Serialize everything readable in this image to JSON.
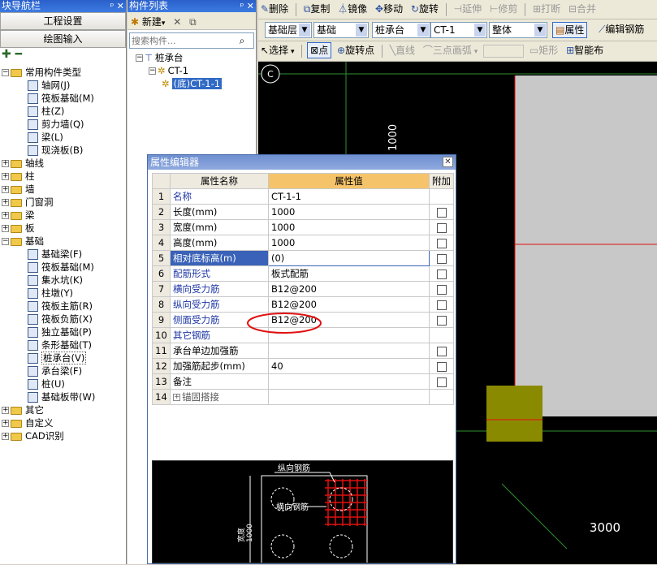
{
  "nav": {
    "title": "块导航栏",
    "controls": "ᵖ ✕",
    "btn_project": "工程设置",
    "btn_draw": "绘图输入",
    "tools": "✚ ━",
    "tree": [
      {
        "label": "常用构件类型",
        "level": 0,
        "type": "folder",
        "exp": "−"
      },
      {
        "label": "轴网(J)",
        "level": 1,
        "type": "item"
      },
      {
        "label": "筏板基础(M)",
        "level": 1,
        "type": "item"
      },
      {
        "label": "柱(Z)",
        "level": 1,
        "type": "item"
      },
      {
        "label": "剪力墙(Q)",
        "level": 1,
        "type": "item"
      },
      {
        "label": "梁(L)",
        "level": 1,
        "type": "item"
      },
      {
        "label": "现浇板(B)",
        "level": 1,
        "type": "item"
      },
      {
        "label": "轴线",
        "level": 0,
        "type": "folder",
        "exp": "+"
      },
      {
        "label": "柱",
        "level": 0,
        "type": "folder",
        "exp": "+"
      },
      {
        "label": "墙",
        "level": 0,
        "type": "folder",
        "exp": "+"
      },
      {
        "label": "门窗洞",
        "level": 0,
        "type": "folder",
        "exp": "+"
      },
      {
        "label": "梁",
        "level": 0,
        "type": "folder",
        "exp": "+"
      },
      {
        "label": "板",
        "level": 0,
        "type": "folder",
        "exp": "+"
      },
      {
        "label": "基础",
        "level": 0,
        "type": "folder",
        "exp": "−"
      },
      {
        "label": "基础梁(F)",
        "level": 1,
        "type": "item"
      },
      {
        "label": "筏板基础(M)",
        "level": 1,
        "type": "item"
      },
      {
        "label": "集水坑(K)",
        "level": 1,
        "type": "item"
      },
      {
        "label": "柱墩(Y)",
        "level": 1,
        "type": "item"
      },
      {
        "label": "筏板主筋(R)",
        "level": 1,
        "type": "item"
      },
      {
        "label": "筏板负筋(X)",
        "level": 1,
        "type": "item"
      },
      {
        "label": "独立基础(P)",
        "level": 1,
        "type": "item"
      },
      {
        "label": "条形基础(T)",
        "level": 1,
        "type": "item"
      },
      {
        "label": "桩承台(V)",
        "level": 1,
        "type": "item",
        "selected": true
      },
      {
        "label": "承台梁(F)",
        "level": 1,
        "type": "item"
      },
      {
        "label": "桩(U)",
        "level": 1,
        "type": "item"
      },
      {
        "label": "基础板带(W)",
        "level": 1,
        "type": "item"
      },
      {
        "label": "其它",
        "level": 0,
        "type": "folder",
        "exp": "+"
      },
      {
        "label": "自定义",
        "level": 0,
        "type": "folder",
        "exp": "+"
      },
      {
        "label": "CAD识别",
        "level": 0,
        "type": "folder",
        "exp": "+"
      }
    ]
  },
  "complist": {
    "title": "构件列表",
    "controls": "ᵖ ✕",
    "new_label": "新建",
    "search_placeholder": "搜索构件...",
    "tree": [
      {
        "label": "桩承台",
        "level": 0
      },
      {
        "label": "CT-1",
        "level": 1
      },
      {
        "label": "(底)CT-1-1",
        "level": 2,
        "selected": true
      }
    ]
  },
  "toolbar1": [
    "删除",
    "复制",
    "镜像",
    "移动",
    "旋转",
    "延伸",
    "修剪",
    "打断",
    "合并"
  ],
  "toolbar2": {
    "combo1": "基础层",
    "combo2": "基础",
    "combo3": "桩承台",
    "combo4": "CT-1",
    "combo5": "整体",
    "attr_btn": "属性",
    "edit_btn": "编辑钢筋"
  },
  "toolbar3": {
    "select": "选择",
    "point": "点",
    "rotate_point": "旋转点",
    "line": "直线",
    "arc": "三点画弧",
    "rect": "矩形",
    "smart": "智能布"
  },
  "canvas": {
    "axis_label": "C",
    "dim_top": "1000",
    "dim_bottom": "3000"
  },
  "prop_editor": {
    "title": "属性编辑器",
    "col_num": "",
    "col_name": "属性名称",
    "col_value": "属性值",
    "col_extra": "附加",
    "rows": [
      {
        "n": "1",
        "name": "名称",
        "value": "CT-1-1",
        "blue": true,
        "chk": false
      },
      {
        "n": "2",
        "name": "长度(mm)",
        "value": "1000",
        "blue": false,
        "chk": true
      },
      {
        "n": "3",
        "name": "宽度(mm)",
        "value": "1000",
        "blue": false,
        "chk": true
      },
      {
        "n": "4",
        "name": "高度(mm)",
        "value": "1000",
        "blue": false,
        "chk": true
      },
      {
        "n": "5",
        "name": "相对底标高(m)",
        "value": "(0)",
        "blue": true,
        "chk": true
      },
      {
        "n": "6",
        "name": "配筋形式",
        "value": "板式配筋",
        "blue": true,
        "chk": true
      },
      {
        "n": "7",
        "name": "横向受力筋",
        "value": "B12@200",
        "blue": true,
        "chk": true
      },
      {
        "n": "8",
        "name": "纵向受力筋",
        "value": "B12@200",
        "blue": true,
        "chk": true
      },
      {
        "n": "9",
        "name": "侧面受力筋",
        "value": "B12@200",
        "blue": true,
        "chk": true
      },
      {
        "n": "10",
        "name": "其它钢筋",
        "value": "",
        "blue": true,
        "chk": false
      },
      {
        "n": "11",
        "name": "承台单边加强筋",
        "value": "",
        "blue": false,
        "chk": true
      },
      {
        "n": "12",
        "name": "加强筋起步(mm)",
        "value": "40",
        "blue": false,
        "chk": true
      },
      {
        "n": "13",
        "name": "备注",
        "value": "",
        "blue": false,
        "chk": true
      },
      {
        "n": "14",
        "name": "锚固搭接",
        "value": "",
        "blue": false,
        "chk": false,
        "expand": "+"
      }
    ],
    "preview": {
      "label_long": "纵向钢筋",
      "label_cross": "横向钢筋",
      "label_side": "宽度",
      "label_side2": "1000"
    }
  },
  "colors": {
    "title_blue": "#3c7be2",
    "grid_green": "#2f8f2f",
    "highlight_row": "#3a62b8",
    "value_header": "#f5c46a",
    "annotation_red": "#e01010"
  }
}
